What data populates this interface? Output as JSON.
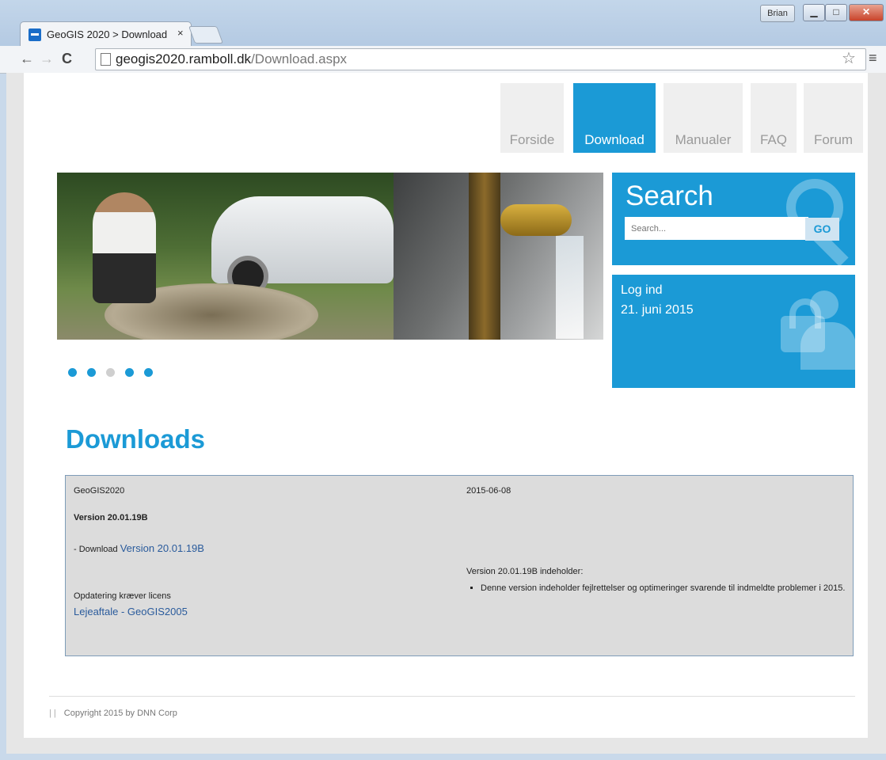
{
  "browser": {
    "tab_title": "GeoGIS 2020 > Download",
    "tab_close": "×",
    "user_name": "Brian",
    "url_domain": "geogis2020.ramboll.dk",
    "url_path": "/Download.aspx"
  },
  "nav": {
    "items": [
      {
        "label": "Forside"
      },
      {
        "label": "Download"
      },
      {
        "label": "Manualer"
      },
      {
        "label": "FAQ"
      },
      {
        "label": "Forum"
      }
    ]
  },
  "search": {
    "title": "Search",
    "placeholder": "Search...",
    "button_label": "GO"
  },
  "login": {
    "label": "Log ind",
    "date": "21. juni 2015"
  },
  "downloads": {
    "heading": "Downloads",
    "product": "GeoGIS2020",
    "release_date": "2015-06-08",
    "version_heading": "Version 20.01.19B",
    "download_prefix": "- Download ",
    "download_link": "Version 20.01.19B",
    "contains_label": "Version 20.01.19B indeholder:",
    "changes": [
      "Denne version indeholder fejlrettelser og optimeringer svarende til indmeldte problemer i 2015."
    ],
    "license_note": "Opdatering kræver licens",
    "license_link": "Lejeaftale - GeoGIS2005"
  },
  "footer": {
    "separator": "| |",
    "copyright": "Copyright 2015 by DNN Corp"
  }
}
